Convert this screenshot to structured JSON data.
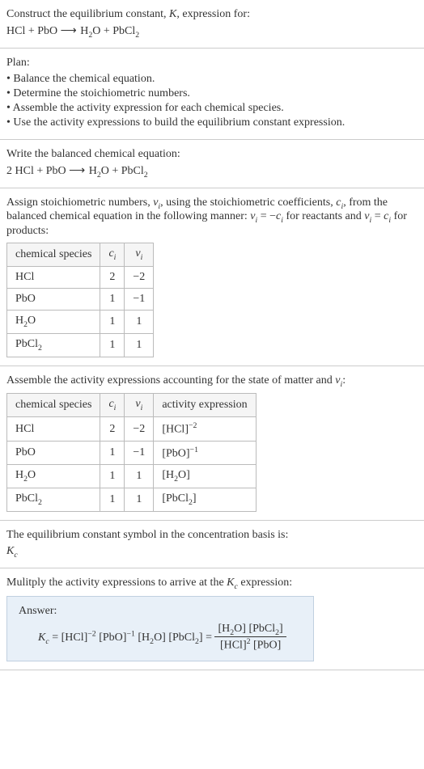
{
  "header": {
    "construct_line": "Construct the equilibrium constant, K, expression for:",
    "equation_unbalanced": "HCl + PbO ⟶ H₂O + PbCl₂"
  },
  "plan": {
    "title": "Plan:",
    "items": [
      "• Balance the chemical equation.",
      "• Determine the stoichiometric numbers.",
      "• Assemble the activity expression for each chemical species.",
      "• Use the activity expressions to build the equilibrium constant expression."
    ]
  },
  "balanced": {
    "intro": "Write the balanced chemical equation:",
    "equation": "2 HCl + PbO ⟶ H₂O + PbCl₂"
  },
  "assign": {
    "text": "Assign stoichiometric numbers, νᵢ, using the stoichiometric coefficients, cᵢ, from the balanced chemical equation in the following manner: νᵢ = −cᵢ for reactants and νᵢ = cᵢ for products:",
    "headers": {
      "species": "chemical species",
      "ci": "cᵢ",
      "vi": "νᵢ"
    },
    "rows": [
      {
        "species": "HCl",
        "ci": "2",
        "vi": "−2"
      },
      {
        "species": "PbO",
        "ci": "1",
        "vi": "−1"
      },
      {
        "species": "H₂O",
        "ci": "1",
        "vi": "1"
      },
      {
        "species": "PbCl₂",
        "ci": "1",
        "vi": "1"
      }
    ]
  },
  "assemble": {
    "text": "Assemble the activity expressions accounting for the state of matter and νᵢ:",
    "headers": {
      "species": "chemical species",
      "ci": "cᵢ",
      "vi": "νᵢ",
      "activity": "activity expression"
    },
    "rows": [
      {
        "species": "HCl",
        "ci": "2",
        "vi": "−2",
        "activity": "[HCl]⁻²"
      },
      {
        "species": "PbO",
        "ci": "1",
        "vi": "−1",
        "activity": "[PbO]⁻¹"
      },
      {
        "species": "H₂O",
        "ci": "1",
        "vi": "1",
        "activity": "[H₂O]"
      },
      {
        "species": "PbCl₂",
        "ci": "1",
        "vi": "1",
        "activity": "[PbCl₂]"
      }
    ]
  },
  "symbol": {
    "text": "The equilibrium constant symbol in the concentration basis is:",
    "value": "K_c"
  },
  "multiply": {
    "text": "Mulitply the activity expressions to arrive at the K_c expression:"
  },
  "answer": {
    "label": "Answer:",
    "lhs": "K_c = [HCl]⁻² [PbO]⁻¹ [H₂O] [PbCl₂] = ",
    "frac_num": "[H₂O] [PbCl₂]",
    "frac_den": "[HCl]² [PbO]"
  }
}
